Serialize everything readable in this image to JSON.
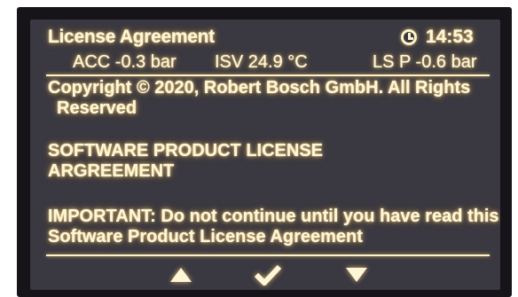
{
  "header": {
    "title": "License Agreement",
    "time": "14:53",
    "clock_icon": "clock-icon"
  },
  "status_bar": {
    "acc": "ACC -0.3 bar",
    "isv": "ISV  24.9 °C",
    "lsp": "LS P -0.6 bar"
  },
  "content": {
    "copyright_line1": "Copyright © 2020, Robert Bosch GmbH.  All Rights",
    "copyright_line2": "Reserved",
    "heading": "SOFTWARE PRODUCT LICENSE ARGREEMENT",
    "important": "IMPORTANT: Do not continue until you have read this Software Product License Agreement"
  },
  "nav": {
    "up_icon": "arrow-up-icon",
    "confirm_icon": "checkmark-icon",
    "down_icon": "arrow-down-icon"
  },
  "colors": {
    "screen_bg": "#3a3840",
    "text_glow": "#fff6d8",
    "bezel": "#161419"
  }
}
